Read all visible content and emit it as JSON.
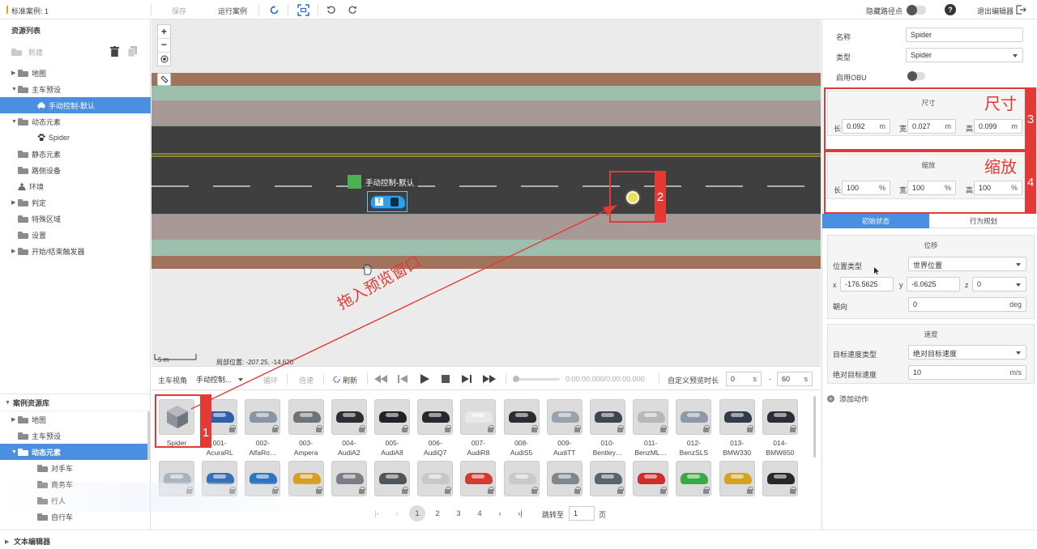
{
  "topbar": {
    "case_title": "标准案例: 1",
    "save": "保存",
    "run": "运行案例",
    "hide_waypoints": "隐藏路径点",
    "help": "?",
    "exit": "退出编辑器"
  },
  "left": {
    "resource_list": "资源列表",
    "new": "新建",
    "tree": [
      {
        "label": "地图",
        "level": 0,
        "arrow": "▶",
        "icon": "folder"
      },
      {
        "label": "主车预设",
        "level": 0,
        "arrow": "▼",
        "icon": "folder-open"
      },
      {
        "label": "手动控制-默认",
        "level": 1,
        "arrow": "",
        "icon": "car",
        "selected": true
      },
      {
        "label": "动态元素",
        "level": 0,
        "arrow": "▼",
        "icon": "folder-open"
      },
      {
        "label": "Spider",
        "level": 1,
        "arrow": "",
        "icon": "paw"
      },
      {
        "label": "静态元素",
        "level": 0,
        "arrow": "",
        "icon": "folder"
      },
      {
        "label": "路侧设备",
        "level": 0,
        "arrow": "",
        "icon": "folder"
      },
      {
        "label": "环境",
        "level": 0,
        "arrow": "",
        "icon": "env"
      },
      {
        "label": "判定",
        "level": 0,
        "arrow": "▶",
        "icon": "folder"
      },
      {
        "label": "特殊区域",
        "level": 0,
        "arrow": "",
        "icon": "folder"
      },
      {
        "label": "设置",
        "level": 0,
        "arrow": "",
        "icon": "file"
      },
      {
        "label": "开始/结束触发器",
        "level": 0,
        "arrow": "▶",
        "icon": "folder"
      }
    ],
    "case_library": "案例资源库",
    "lib_tree": [
      {
        "label": "地图",
        "level": 0,
        "arrow": "▶"
      },
      {
        "label": "主车预设",
        "level": 0,
        "arrow": ""
      },
      {
        "label": "动态元素",
        "level": 0,
        "arrow": "▼",
        "selected": true
      },
      {
        "label": "对手车",
        "level": 1,
        "arrow": ""
      },
      {
        "label": "商务车",
        "level": 1,
        "arrow": ""
      },
      {
        "label": "行人",
        "level": 1,
        "arrow": ""
      },
      {
        "label": "自行车",
        "level": 1,
        "arrow": ""
      }
    ]
  },
  "canvas": {
    "vehicle_label": "手动控制-默认",
    "scale": "5 m",
    "position": "局部位置: -207.25, -14.620",
    "annotation": "拖入预览窗口",
    "tag2": "2"
  },
  "controls": {
    "main_view": "主车视角",
    "view_select": "手动控制...",
    "loop": "循环",
    "speed": "倍速",
    "refresh": "刷新",
    "time": "0:00:00.000/0:00:00.000",
    "custom_preview": "自定义预览时长",
    "start": "0",
    "start_unit": "s",
    "dash": "-",
    "end": "60",
    "end_unit": "s"
  },
  "library": {
    "tag1": "1",
    "items_row1": [
      {
        "label": "Spider",
        "color": "#9aa0a6"
      },
      {
        "label": "001-AcuraRL",
        "color": "#2e5fa8"
      },
      {
        "label": "002-AlfaRo…",
        "color": "#8a95a3"
      },
      {
        "label": "003-Ampera",
        "color": "#6e7378"
      },
      {
        "label": "004-AudiA2",
        "color": "#2b2e33"
      },
      {
        "label": "005-AudiA8",
        "color": "#1f2226"
      },
      {
        "label": "006-AudiQ7",
        "color": "#25282c"
      },
      {
        "label": "007-AudiR8",
        "color": "#e8e8e8"
      },
      {
        "label": "008-AudiS5",
        "color": "#2a2d31"
      },
      {
        "label": "009-AudiTT",
        "color": "#9aa3ad"
      },
      {
        "label": "010-Bentley…",
        "color": "#3d4550"
      },
      {
        "label": "011-BenzML…",
        "color": "#b5b8bb"
      },
      {
        "label": "012-BenzSLS",
        "color": "#8d99a6"
      },
      {
        "label": "013-BMW330",
        "color": "#2f3a4a"
      },
      {
        "label": "014-BMW650",
        "color": "#2a2d33"
      }
    ],
    "items_row2": [
      {
        "color": "#aab4c0"
      },
      {
        "color": "#3a6fb5"
      },
      {
        "color": "#2d74c4"
      },
      {
        "color": "#d4a021"
      },
      {
        "color": "#7a7f85"
      },
      {
        "color": "#50555a"
      },
      {
        "color": "#c8c8c8"
      },
      {
        "color": "#d23b2e"
      },
      {
        "color": "#c9c9c9"
      },
      {
        "color": "#7e868e"
      },
      {
        "color": "#5a636d"
      },
      {
        "color": "#d12c2c"
      },
      {
        "color": "#3aa844"
      },
      {
        "color": "#d4a21e"
      },
      {
        "color": "#25282c"
      }
    ],
    "pages": [
      "1",
      "2",
      "3",
      "4"
    ],
    "jump_to": "跳转至",
    "page_value": "1",
    "page_unit": "页"
  },
  "right": {
    "name_label": "名称",
    "name_value": "Spider",
    "type_label": "类型",
    "type_value": "Spider",
    "obu_label": "启用OBU",
    "size_title": "尺寸",
    "size_annot": "尺寸",
    "tag3": "3",
    "length_label": "长",
    "length_value": "0.092",
    "width_label": "宽",
    "width_value": "0.027",
    "height_label": "高",
    "height_value": "0.099",
    "unit_m": "m",
    "scale_title": "缩放",
    "scale_annot": "缩放",
    "tag4": "4",
    "scale_l": "100",
    "scale_w": "100",
    "scale_h": "100",
    "unit_pct": "%",
    "tab_initial": "初始状态",
    "tab_behavior": "行为规划",
    "displacement": "位移",
    "pos_type_label": "位置类型",
    "pos_type_value": "世界位置",
    "x_label": "x",
    "x_value": "-176.5625",
    "y_label": "y",
    "y_value": "-6.0625",
    "z_label": "z",
    "z_value": "0",
    "heading_label": "朝向",
    "heading_value": "0",
    "heading_unit": "deg",
    "speed_title": "速度",
    "target_speed_type_label": "目标速度类型",
    "target_speed_type_value": "绝对目标速度",
    "abs_speed_label": "绝对目标速度",
    "abs_speed_value": "10",
    "speed_unit": "m/s",
    "add_action": "添加动作"
  },
  "bottombar": {
    "text_editor": "文本编辑器"
  },
  "colors": {
    "accent": "#4a90e2",
    "annotation": "#e53935",
    "road": "#3f3f3f",
    "soil": "#a0735a",
    "grass": "#9cbfae"
  }
}
